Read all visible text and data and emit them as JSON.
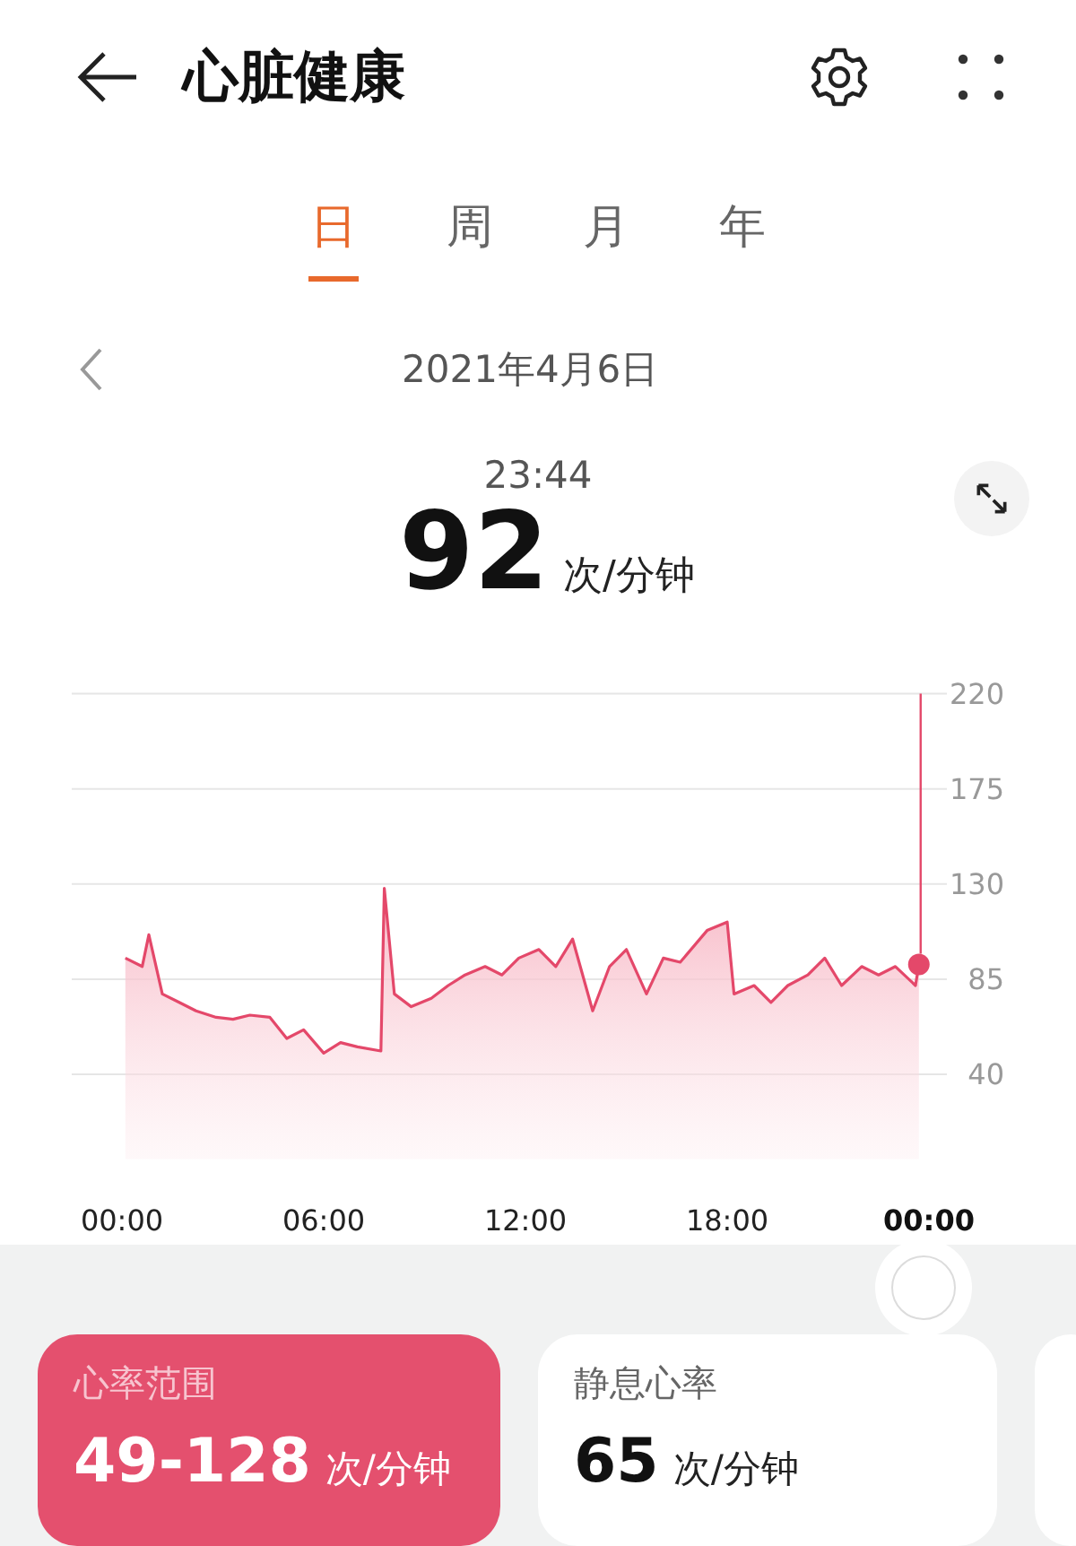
{
  "header": {
    "title": "心脏健康"
  },
  "tabs": [
    {
      "label": "日",
      "selected": true
    },
    {
      "label": "周",
      "selected": false
    },
    {
      "label": "月",
      "selected": false
    },
    {
      "label": "年",
      "selected": false
    }
  ],
  "date": "2021年4月6日",
  "reading": {
    "time": "23:44",
    "value": "92",
    "unit": "次/分钟"
  },
  "chart": {
    "chart_data": {
      "type": "area",
      "x": [
        0.1,
        0.6,
        0.8,
        1.2,
        1.7,
        2.2,
        2.8,
        3.3,
        3.8,
        4.4,
        4.9,
        5.4,
        6.0,
        6.5,
        7.0,
        7.7,
        7.8,
        8.1,
        8.6,
        9.2,
        9.7,
        10.2,
        10.8,
        11.3,
        11.8,
        12.4,
        12.9,
        13.4,
        14.0,
        14.5,
        15.0,
        15.6,
        16.1,
        16.6,
        17.4,
        18.0,
        18.2,
        18.8,
        19.3,
        19.8,
        20.4,
        20.9,
        21.4,
        22.0,
        22.5,
        23.0,
        23.6,
        23.7
      ],
      "series": [
        {
          "color": "#e4486a",
          "values": [
            95,
            91,
            106,
            78,
            74,
            70,
            67,
            66,
            68,
            67,
            57,
            61,
            50,
            55,
            53,
            51,
            128,
            78,
            72,
            76,
            82,
            87,
            91,
            87,
            95,
            99,
            91,
            104,
            70,
            91,
            99,
            78,
            95,
            93,
            108,
            112,
            78,
            82,
            74,
            82,
            87,
            95,
            82,
            91,
            87,
            91,
            82,
            92
          ]
        }
      ],
      "xticks": [
        {
          "value": 0,
          "label": "00:00"
        },
        {
          "value": 6,
          "label": "06:00"
        },
        {
          "value": 12,
          "label": "12:00"
        },
        {
          "value": 18,
          "label": "18:00"
        },
        {
          "value": 24,
          "label": "00:00"
        }
      ],
      "xlim": [
        0,
        24
      ],
      "ylim": [
        40,
        220
      ],
      "yticks": [
        {
          "value": 40,
          "label": "40"
        },
        {
          "value": 85,
          "label": "85"
        },
        {
          "value": 130,
          "label": "130"
        },
        {
          "value": 175,
          "label": "175"
        },
        {
          "value": 220,
          "label": "220"
        }
      ],
      "grid": true
    }
  },
  "cards": [
    {
      "title": "心率范围",
      "value": "49-128",
      "unit": "次/分钟",
      "selected": true
    },
    {
      "title": "静息心率",
      "value": "65",
      "unit": "次/分钟",
      "selected": false
    }
  ]
}
